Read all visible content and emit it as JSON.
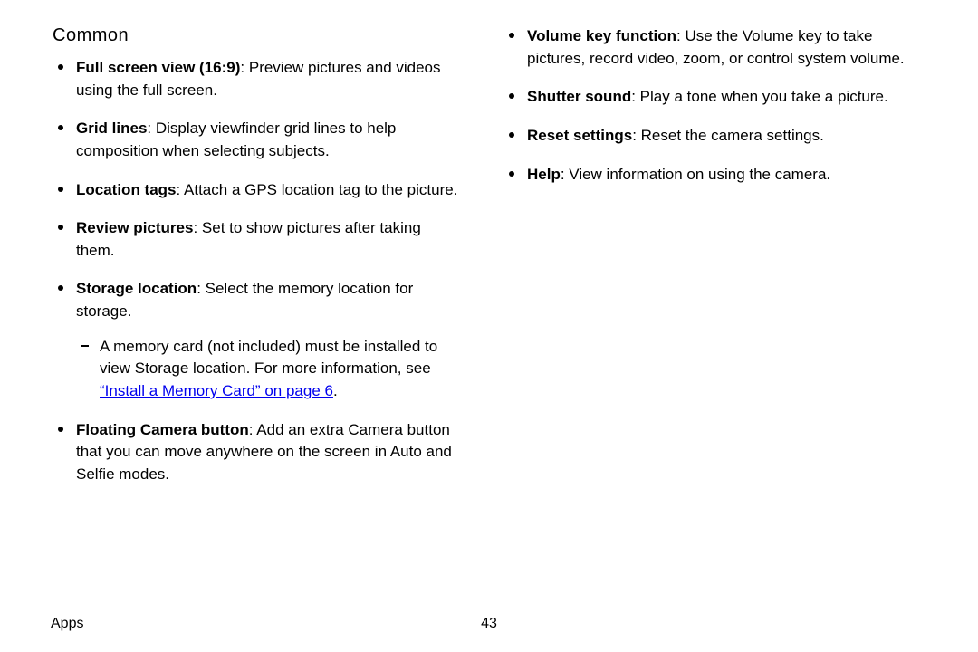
{
  "heading": "Common",
  "left": [
    {
      "term": "Full screen view (16:9)",
      "desc": ": Preview pictures and videos using the full screen."
    },
    {
      "term": "Grid lines",
      "desc": ": Display viewfinder grid lines to help composition when selecting subjects."
    },
    {
      "term": "Location tags",
      "desc": ": Attach a GPS location tag to the picture."
    },
    {
      "term": "Review pictures",
      "desc": ": Set to show pictures after taking them."
    },
    {
      "term": "Storage location",
      "desc": ": Select the memory location for storage.",
      "sub_pre": "A memory card (not included) must be installed to view Storage location. For more information, see ",
      "sub_link": "“Install a Memory Card” on page 6",
      "sub_post": "."
    },
    {
      "term": "Floating Camera button",
      "desc": ": Add an extra Camera button that you can move anywhere on the screen in Auto and Selfie modes."
    }
  ],
  "right": [
    {
      "term": "Volume key function",
      "desc": ": Use the Volume key to take pictures, record video, zoom, or control system volume."
    },
    {
      "term": "Shutter sound",
      "desc": ": Play a tone when you take a picture."
    },
    {
      "term": "Reset settings",
      "desc": ": Reset the camera settings."
    },
    {
      "term": "Help",
      "desc": ": View information on using the camera."
    }
  ],
  "footer": {
    "section": "Apps",
    "page": "43"
  }
}
